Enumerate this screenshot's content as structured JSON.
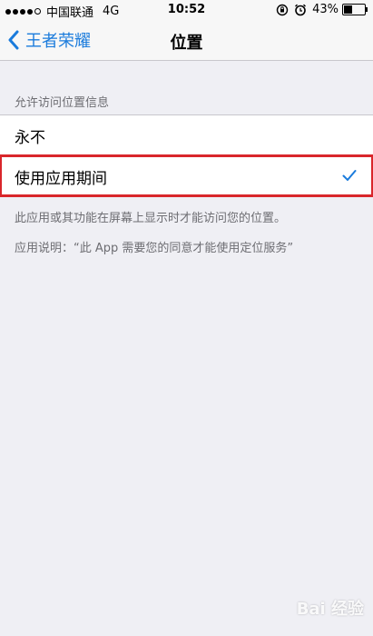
{
  "status_bar": {
    "carrier": "中国联通",
    "network": "4G",
    "time": "10:52",
    "battery_percent": "43%",
    "battery_level": 0.43
  },
  "nav": {
    "back_label": "王者荣耀",
    "title": "位置"
  },
  "section": {
    "header": "允许访问位置信息",
    "options": [
      {
        "label": "永不",
        "selected": false
      },
      {
        "label": "使用应用期间",
        "selected": true
      }
    ]
  },
  "footer": {
    "note": "此应用或其功能在屏幕上显示时才能访问您的位置。",
    "app_explanation": "应用说明：“此 App 需要您的同意才能使用定位服务”"
  },
  "colors": {
    "accent": "#1a7bdc",
    "highlight": "#d9262b"
  },
  "watermark": {
    "text": "Bai 经验"
  }
}
